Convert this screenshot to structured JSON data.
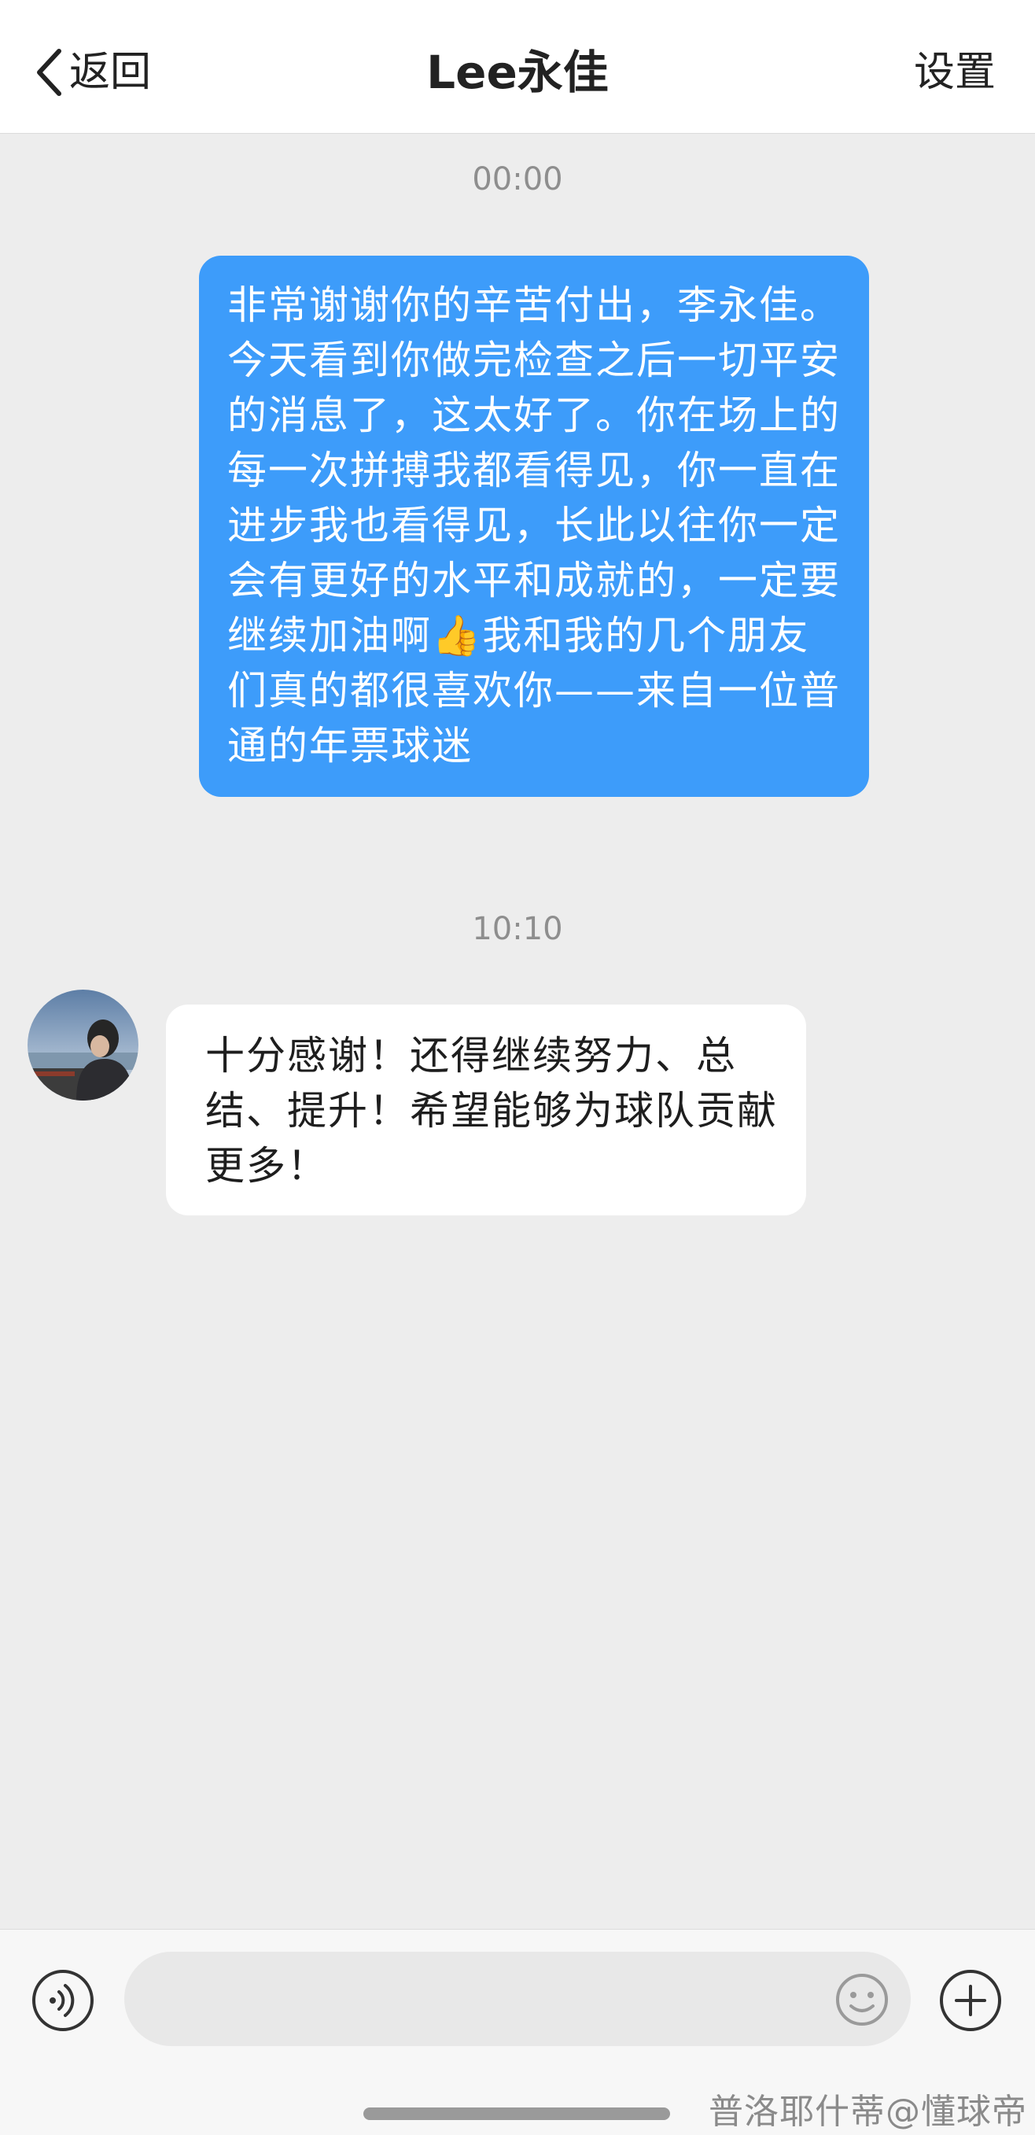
{
  "header": {
    "back_label": "返回",
    "title": "Lee永佳",
    "settings_label": "设置"
  },
  "messages": [
    {
      "timestamp": "00:00",
      "direction": "outgoing",
      "text": "非常谢谢你的辛苦付出，李永佳。今天看到你做完检查之后一切平安的消息了，这太好了。你在场上的每一次拼搏我都看得见，你一直在进步我也看得见，长此以往你一定会有更好的水平和成就的，一定要继续加油啊👍我和我的几个朋友们真的都很喜欢你——来自一位普通的年票球迷"
    },
    {
      "timestamp": "10:10",
      "direction": "incoming",
      "text": "十分感谢！还得继续努力、总结、提升！希望能够为球队贡献更多！"
    }
  ],
  "input": {
    "value": "",
    "placeholder": ""
  },
  "watermark": "普洛耶什蒂@懂球帝",
  "colors": {
    "outgoing_bubble": "#3d9cfa",
    "incoming_bubble": "#ffffff",
    "chat_background": "#ededed"
  },
  "icons": {
    "back": "chevron-left-icon",
    "voice": "voice-icon",
    "emoji": "emoji-icon",
    "plus": "plus-icon"
  }
}
